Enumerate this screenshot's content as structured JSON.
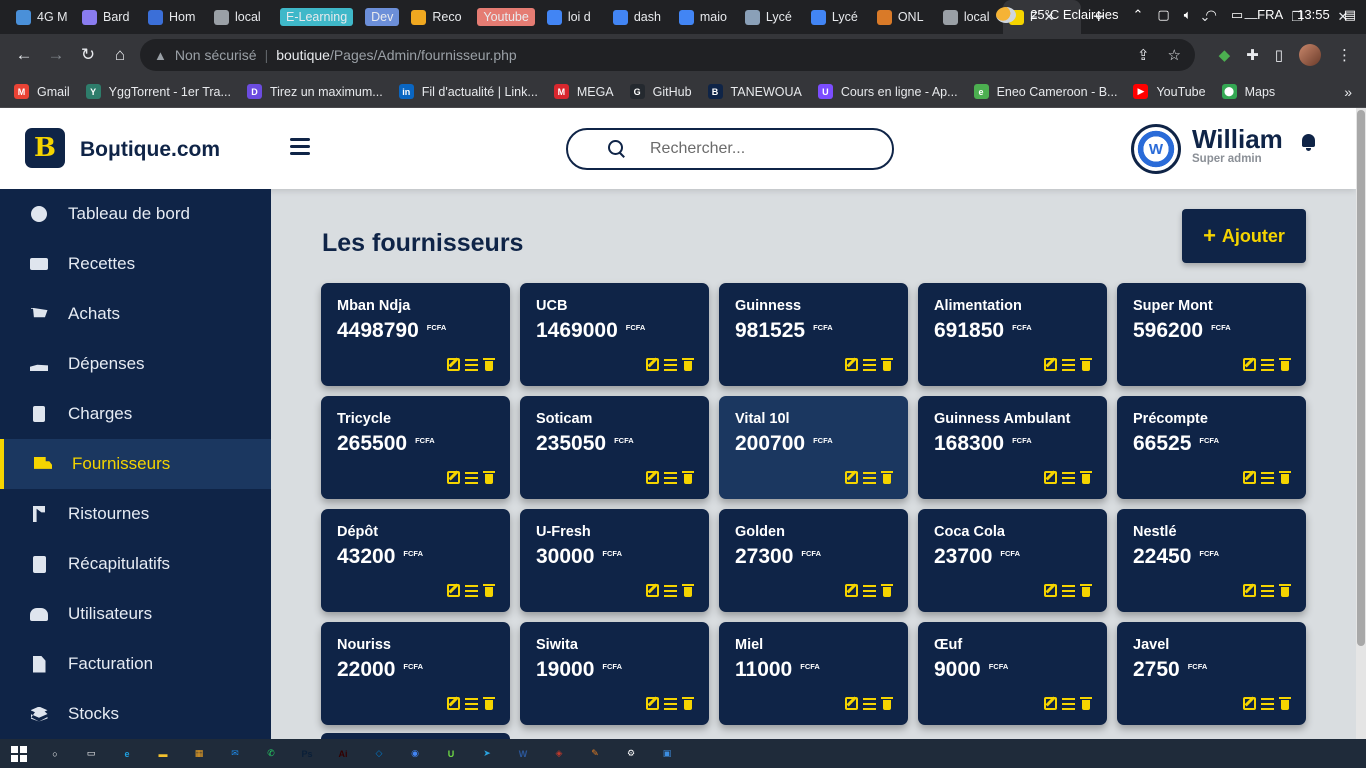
{
  "browser": {
    "tabs": [
      {
        "label": "4G M",
        "icon": "globe-icon",
        "color": "#4a90d9"
      },
      {
        "label": "Bard",
        "icon": "bard-icon",
        "color": "#8a7cf0"
      },
      {
        "label": "Hom",
        "icon": "globe-icon",
        "color": "#3b6fd8"
      },
      {
        "label": "local",
        "icon": "localhost-icon",
        "color": "#9aa0a6"
      },
      {
        "label": "E-Learning",
        "icon": "",
        "color": "#3fb8c9",
        "pill": true
      },
      {
        "label": "Dev",
        "icon": "",
        "color": "#6c8fd9",
        "pill": true
      },
      {
        "label": "Reco",
        "icon": "g-icon",
        "color": "#f0a820"
      },
      {
        "label": "Youtube",
        "icon": "",
        "color": "#e57c73",
        "pill": true
      },
      {
        "label": "loi d",
        "icon": "google-icon",
        "color": "#4285f4"
      },
      {
        "label": "dash",
        "icon": "google-icon",
        "color": "#4285f4"
      },
      {
        "label": "maio",
        "icon": "google-icon",
        "color": "#4285f4"
      },
      {
        "label": "Lycé",
        "icon": "lycee-icon",
        "color": "#8aa0b8"
      },
      {
        "label": "Lycé",
        "icon": "google-icon",
        "color": "#4285f4"
      },
      {
        "label": "ONL",
        "icon": "stack-icon",
        "color": "#d97a28"
      },
      {
        "label": "local",
        "icon": "wamp-icon",
        "color": "#9aa0a6"
      },
      {
        "label": "F",
        "icon": "boutique-icon",
        "color": "#f5d400",
        "active": true
      }
    ],
    "close_glyph": "✕",
    "new_tab_glyph": "+",
    "address": {
      "security": "Non sécurisé",
      "host": "boutique",
      "path": "/Pages/Admin/fournisseur.php"
    },
    "bookmarks": [
      {
        "label": "Gmail",
        "color": "#ea4335",
        "glyph": "M"
      },
      {
        "label": "YggTorrent - 1er Tra...",
        "color": "#2e7d6b",
        "glyph": "Y"
      },
      {
        "label": "Tirez un maximum...",
        "color": "#6c4ce0",
        "glyph": "D"
      },
      {
        "label": "Fil d'actualité | Link...",
        "color": "#0a66c2",
        "glyph": "in"
      },
      {
        "label": "MEGA",
        "color": "#d9272e",
        "glyph": "M"
      },
      {
        "label": "GitHub",
        "color": "#24292f",
        "glyph": "G"
      },
      {
        "label": "TANEWOUA",
        "color": "#0f2447",
        "glyph": "B"
      },
      {
        "label": "Cours en ligne - Ap...",
        "color": "#7c4dff",
        "glyph": "U"
      },
      {
        "label": "Eneo Cameroon - B...",
        "color": "#4caf50",
        "glyph": "e"
      },
      {
        "label": "YouTube",
        "color": "#ff0000",
        "glyph": "▶"
      },
      {
        "label": "Maps",
        "color": "#34a853",
        "glyph": "⬤"
      }
    ]
  },
  "header": {
    "logo_letter": "B",
    "brand": "Boμtique.com",
    "search_placeholder": "Rechercher...",
    "user_name": "William",
    "user_role": "Super admin",
    "avatar_initials": "W"
  },
  "sidebar": {
    "items": [
      {
        "label": "Tableau de bord",
        "icon": "dashboard-icon"
      },
      {
        "label": "Recettes",
        "icon": "cash-icon"
      },
      {
        "label": "Achats",
        "icon": "cart-icon"
      },
      {
        "label": "Dépenses",
        "icon": "hand-coin-icon"
      },
      {
        "label": "Charges",
        "icon": "invoice-icon"
      },
      {
        "label": "Fournisseurs",
        "icon": "truck-icon",
        "active": true
      },
      {
        "label": "Ristournes",
        "icon": "branch-icon"
      },
      {
        "label": "Récapitulatifs",
        "icon": "clipboard-icon"
      },
      {
        "label": "Utilisateurs",
        "icon": "users-icon"
      },
      {
        "label": "Facturation",
        "icon": "file-icon"
      },
      {
        "label": "Stocks",
        "icon": "layers-icon"
      }
    ]
  },
  "main": {
    "title": "Les fournisseurs",
    "add_label": "Ajouter",
    "add_glyph": "+",
    "currency": "FCFA",
    "suppliers": [
      {
        "name": "Mban Ndja",
        "amount": "4498790"
      },
      {
        "name": "UCB",
        "amount": "1469000"
      },
      {
        "name": "Guinness",
        "amount": "981525"
      },
      {
        "name": "Alimentation",
        "amount": "691850"
      },
      {
        "name": "Super Mont",
        "amount": "596200"
      },
      {
        "name": "Tricycle",
        "amount": "265500"
      },
      {
        "name": "Soticam",
        "amount": "235050"
      },
      {
        "name": "Vital 10l",
        "amount": "200700",
        "highlight": true
      },
      {
        "name": "Guinness Ambulant",
        "amount": "168300"
      },
      {
        "name": "Précompte",
        "amount": "66525"
      },
      {
        "name": "Dépôt",
        "amount": "43200"
      },
      {
        "name": "U-Fresh",
        "amount": "30000"
      },
      {
        "name": "Golden",
        "amount": "27300"
      },
      {
        "name": "Coca Cola",
        "amount": "23700"
      },
      {
        "name": "Nestlé",
        "amount": "22450"
      },
      {
        "name": "Nouriss",
        "amount": "22000"
      },
      {
        "name": "Siwita",
        "amount": "19000"
      },
      {
        "name": "Miel",
        "amount": "11000"
      },
      {
        "name": "Œuf",
        "amount": "9000"
      },
      {
        "name": "Javel",
        "amount": "2750"
      }
    ]
  },
  "taskbar": {
    "apps": [
      {
        "name": "search-taskbar-icon",
        "color": "#ffffff",
        "glyph": "○"
      },
      {
        "name": "taskview-icon",
        "color": "#ffffff",
        "glyph": "▭"
      },
      {
        "name": "edge-icon",
        "color": "#1fa0e0",
        "glyph": "e"
      },
      {
        "name": "explorer-icon",
        "color": "#f2c12e",
        "glyph": "▬"
      },
      {
        "name": "store-icon",
        "color": "#f5a623",
        "glyph": "▦"
      },
      {
        "name": "mail-icon",
        "color": "#1e88e5",
        "glyph": "✉"
      },
      {
        "name": "whatsapp-icon",
        "color": "#25d366",
        "glyph": "✆"
      },
      {
        "name": "photoshop-icon",
        "color": "#0a1f38",
        "glyph": "Ps"
      },
      {
        "name": "illustrator-icon",
        "color": "#330000",
        "glyph": "Ai"
      },
      {
        "name": "vscode-icon",
        "color": "#007acc",
        "glyph": "◇"
      },
      {
        "name": "chrome-icon",
        "color": "#4285f4",
        "glyph": "◉"
      },
      {
        "name": "upwork-icon",
        "color": "#6fda44",
        "glyph": "U"
      },
      {
        "name": "telegram-icon",
        "color": "#2aa3df",
        "glyph": "➤"
      },
      {
        "name": "word-icon",
        "color": "#2b579a",
        "glyph": "W"
      },
      {
        "name": "game-icon",
        "color": "#c0392b",
        "glyph": "◈"
      },
      {
        "name": "paint-icon",
        "color": "#e67e22",
        "glyph": "✎"
      },
      {
        "name": "settings-icon",
        "color": "#ffffff",
        "glyph": "⚙"
      },
      {
        "name": "photos-icon",
        "color": "#3d8ee0",
        "glyph": "▣"
      }
    ],
    "weather": "25°C  Eclaircies",
    "language": "FRA",
    "time": "13:55"
  }
}
